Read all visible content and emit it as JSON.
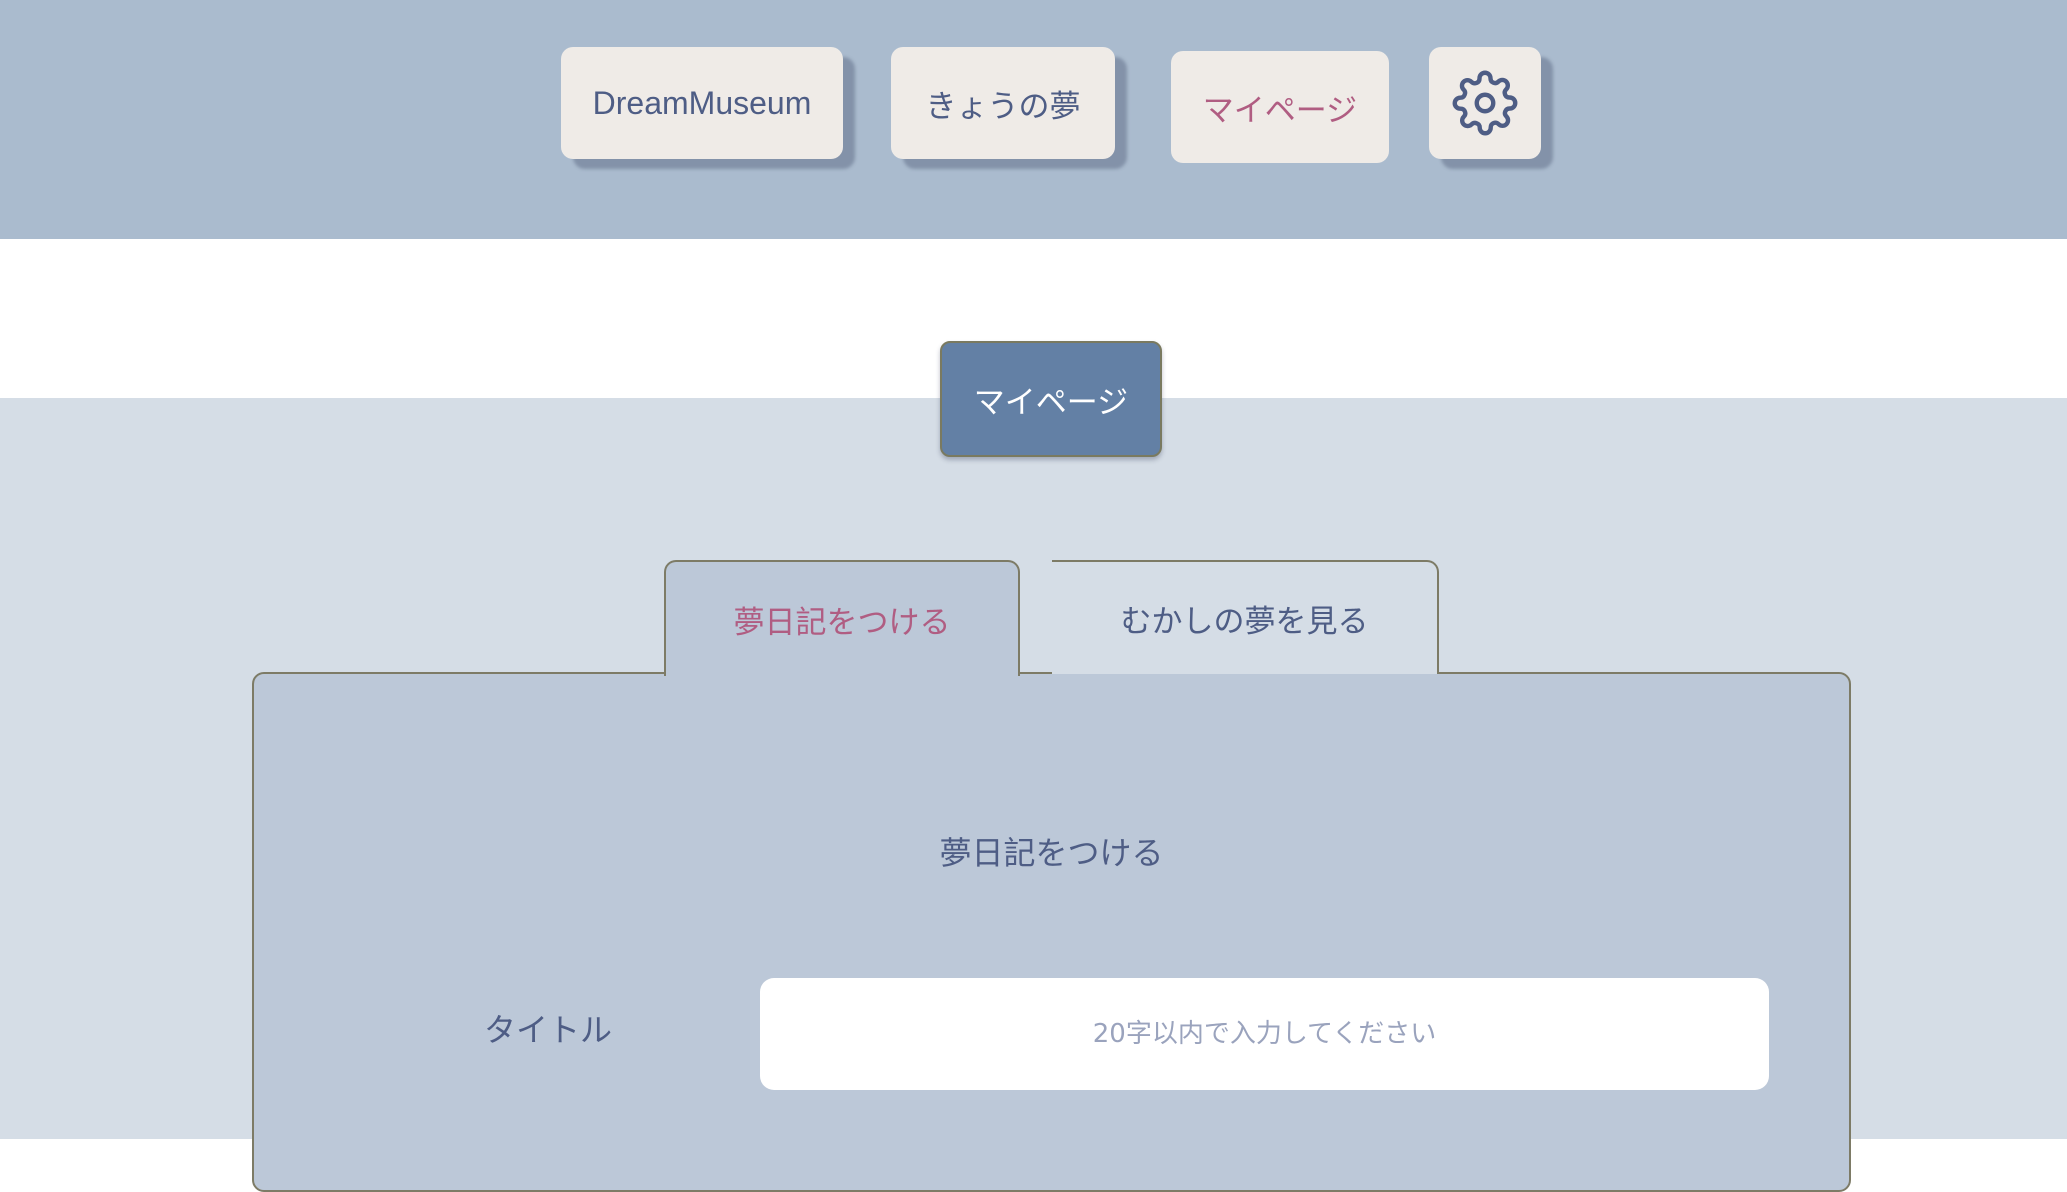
{
  "header": {
    "nav": {
      "brand": "DreamMuseum",
      "today": "きょうの夢",
      "mypage": "マイページ",
      "settings_icon": "gear-icon"
    }
  },
  "page": {
    "title": "マイページ"
  },
  "tabs": [
    {
      "label": "夢日記をつける",
      "active": true
    },
    {
      "label": "むかしの夢を見る",
      "active": false
    }
  ],
  "form": {
    "heading": "夢日記をつける",
    "title_label": "タイトル",
    "title_placeholder": "20字以内で入力してください",
    "title_value": ""
  },
  "colors": {
    "header_bg": "#aabbce",
    "nav_button_bg": "#efebe7",
    "text_primary": "#4e5d85",
    "accent_pink": "#b05d82",
    "page_title_bg": "#6380a5",
    "panel_bg": "#bcc8d8",
    "main_bg": "#d5dde6"
  }
}
